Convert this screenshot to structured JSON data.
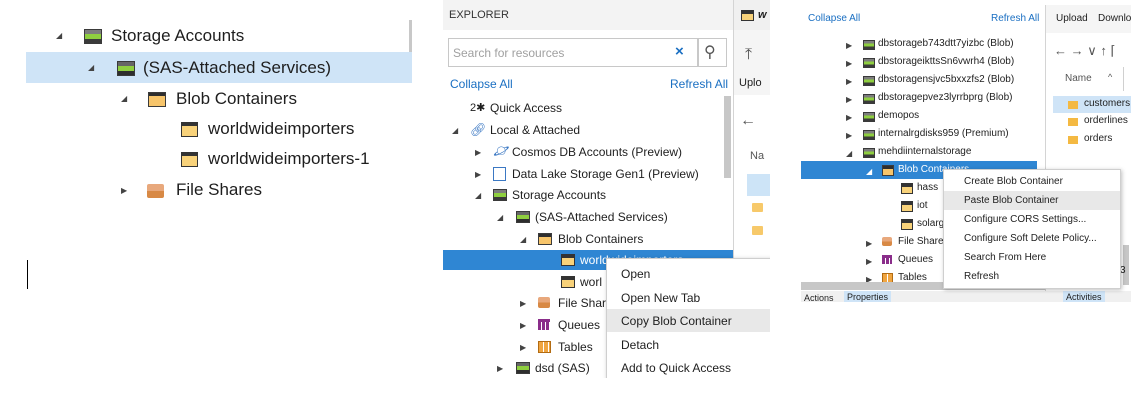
{
  "panel1": {
    "items": [
      {
        "label": "Storage Accounts"
      },
      {
        "label": "(SAS-Attached Services)"
      },
      {
        "label": "Blob Containers"
      },
      {
        "label": "worldwideimporters"
      },
      {
        "label": "worldwideimporters-1"
      },
      {
        "label": "File Shares"
      }
    ]
  },
  "panel2": {
    "header": "EXPLORER",
    "tab_label": "w",
    "search_placeholder": "Search for resources",
    "collapse_all": "Collapse All",
    "refresh_all": "Refresh All",
    "partial_upload": "Uplo",
    "partial_name": "Na",
    "tree": [
      {
        "label": "Quick Access"
      },
      {
        "label": "Local & Attached"
      },
      {
        "label": "Cosmos DB Accounts (Preview)"
      },
      {
        "label": "Data Lake Storage Gen1 (Preview)"
      },
      {
        "label": "Storage Accounts"
      },
      {
        "label": "(SAS-Attached Services)"
      },
      {
        "label": "Blob Containers"
      },
      {
        "label": "worldwideimporters"
      },
      {
        "label": "worl"
      },
      {
        "label": "File Share"
      },
      {
        "label": "Queues"
      },
      {
        "label": "Tables"
      },
      {
        "label": "dsd (SAS)"
      }
    ],
    "context_menu": [
      {
        "label": "Open"
      },
      {
        "label": "Open New Tab"
      },
      {
        "label": "Copy Blob Container"
      },
      {
        "label": "Detach"
      },
      {
        "label": "Add to Quick Access"
      }
    ]
  },
  "panel3": {
    "collapse_all": "Collapse All",
    "refresh_all": "Refresh All",
    "toolbar_upload": "Upload",
    "toolbar_download": "Downlo",
    "column_name": "Name",
    "files": [
      {
        "label": "customers"
      },
      {
        "label": "orderlines"
      },
      {
        "label": "orders"
      }
    ],
    "tree": [
      {
        "label": "dbstorageb743dtt7yizbc (Blob)"
      },
      {
        "label": "dbstorageikttsSn6vwrh4 (Blob)"
      },
      {
        "label": "dbstoragensjvc5bxxzfs2 (Blob)"
      },
      {
        "label": "dbstoragepvez3lyrrbprg (Blob)"
      },
      {
        "label": "demopos"
      },
      {
        "label": "internalrgdisks959 (Premium)"
      },
      {
        "label": "mehdiinternalstorage"
      },
      {
        "label": "Blob Containers"
      },
      {
        "label": "hass"
      },
      {
        "label": "iot"
      },
      {
        "label": "solarg"
      },
      {
        "label": "File Shares"
      },
      {
        "label": "Queues"
      },
      {
        "label": "Tables"
      }
    ],
    "context_menu": [
      {
        "label": "Create Blob Container"
      },
      {
        "label": "Paste Blob Container"
      },
      {
        "label": "Configure CORS Settings..."
      },
      {
        "label": "Configure Soft Delete Policy..."
      },
      {
        "label": "Search From Here"
      },
      {
        "label": "Refresh"
      }
    ],
    "bottom_tabs": [
      {
        "label": "Actions"
      },
      {
        "label": "Properties"
      },
      {
        "label": "Activities"
      }
    ],
    "partial_number": "3"
  }
}
